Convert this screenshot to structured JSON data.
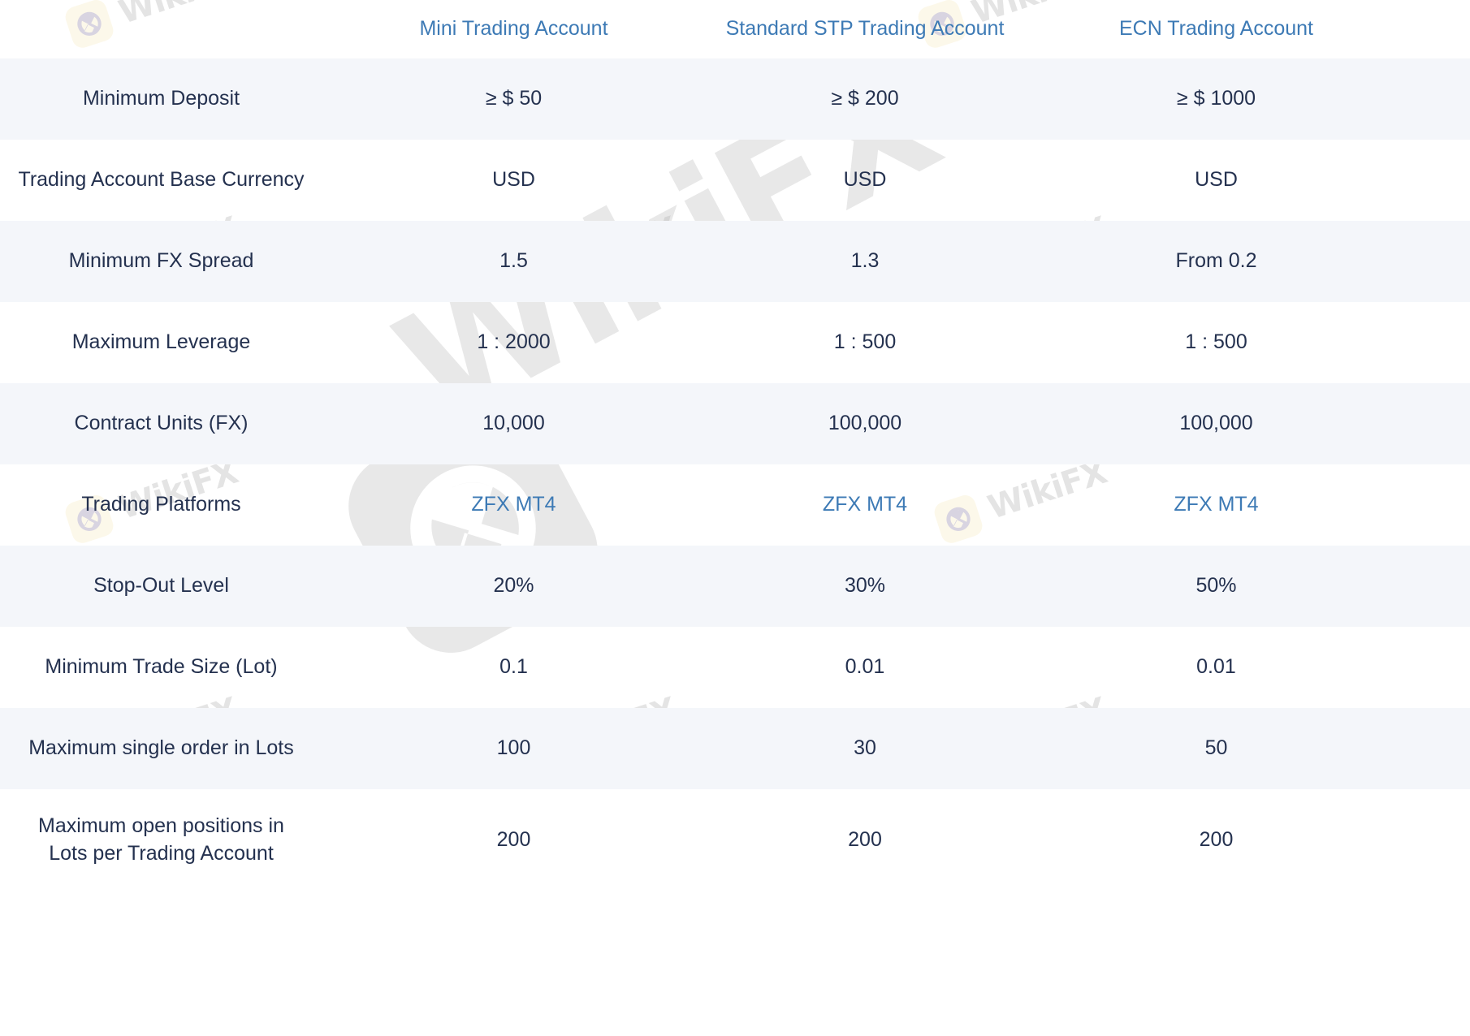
{
  "table": {
    "columns": [
      {
        "label": "",
        "name": "feature-column"
      },
      {
        "label": "Mini Trading Account",
        "name": "mini-trading-account"
      },
      {
        "label": "Standard STP Trading Account",
        "name": "standard-stp-trading-account"
      },
      {
        "label": "ECN Trading Account",
        "name": "ecn-trading-account"
      }
    ],
    "rows": [
      {
        "label": "Minimum Deposit",
        "mini": "≥ $ 50",
        "standard": "≥ $ 200",
        "ecn": "≥ $ 1000"
      },
      {
        "label": "Trading Account Base Currency",
        "mini": "USD",
        "standard": "USD",
        "ecn": "USD"
      },
      {
        "label": "Minimum FX Spread",
        "mini": "1.5",
        "standard": "1.3",
        "ecn": "From 0.2"
      },
      {
        "label": "Maximum Leverage",
        "mini": "1 : 2000",
        "standard": "1 : 500",
        "ecn": "1 : 500"
      },
      {
        "label": "Contract Units (FX)",
        "mini": "10,000",
        "standard": "100,000",
        "ecn": "100,000"
      },
      {
        "label": "Trading Platforms",
        "mini": "ZFX MT4",
        "standard": "ZFX MT4",
        "ecn": "ZFX MT4",
        "link": true
      },
      {
        "label": "Stop-Out Level",
        "mini": "20%",
        "standard": "30%",
        "ecn": "50%"
      },
      {
        "label": "Minimum Trade Size (Lot)",
        "mini": "0.1",
        "standard": "0.01",
        "ecn": "0.01"
      },
      {
        "label": "Maximum single order in Lots",
        "mini": "100",
        "standard": "30",
        "ecn": "50"
      }
    ],
    "last_row": {
      "label_line1": "Maximum open positions in",
      "label_line2": "Lots per Trading Account",
      "mini": "200",
      "standard": "200",
      "ecn": "200"
    }
  },
  "watermark": {
    "text": "WikiFX",
    "logo_name": "wikifx-eagle-logo",
    "badge_color": "#fbf3d9",
    "text_color": "#cfcfcf"
  },
  "colors": {
    "stripe": "#f4f6fa",
    "text": "#24314f",
    "link": "#3d7ab5",
    "background": "#ffffff"
  }
}
